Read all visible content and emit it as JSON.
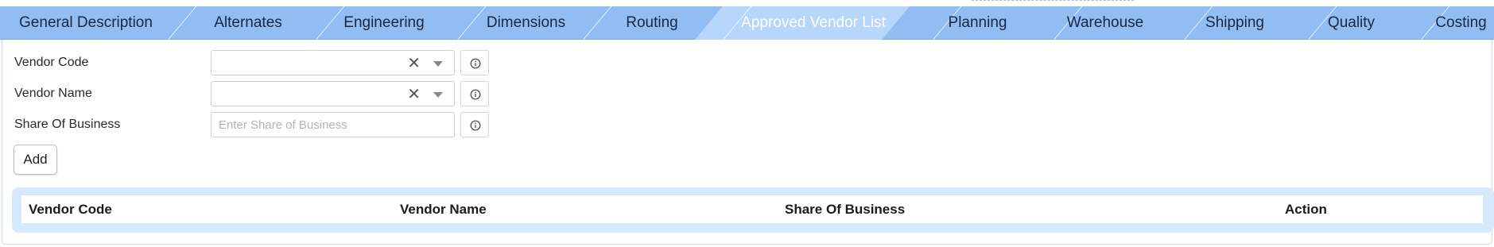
{
  "tabs": [
    {
      "label": "General Description",
      "active": false
    },
    {
      "label": "Alternates",
      "active": false
    },
    {
      "label": "Engineering",
      "active": false
    },
    {
      "label": "Dimensions",
      "active": false
    },
    {
      "label": "Routing",
      "active": false
    },
    {
      "label": "Approved Vendor List",
      "active": true
    },
    {
      "label": "Planning",
      "active": false
    },
    {
      "label": "Warehouse",
      "active": false
    },
    {
      "label": "Shipping",
      "active": false
    },
    {
      "label": "Quality",
      "active": false
    },
    {
      "label": "Costing",
      "active": false
    }
  ],
  "form": {
    "vendor_code": {
      "label": "Vendor Code",
      "value": ""
    },
    "vendor_name": {
      "label": "Vendor Name",
      "value": ""
    },
    "share_of_business": {
      "label": "Share Of Business",
      "value": "",
      "placeholder": "Enter Share of Business"
    },
    "add_label": "Add",
    "clear_glyph": "✕"
  },
  "table": {
    "columns": [
      "Vendor Code",
      "Vendor Name",
      "Share Of Business",
      "Action"
    ],
    "rows": []
  },
  "icons": {
    "info": "info-circle-icon",
    "clear": "close-icon",
    "dropdown": "caret-down-icon"
  },
  "colors": {
    "tabbar": "#91bdf3",
    "tab_active": "#b7d6fb",
    "grid_wrap": "#d6e8fc"
  }
}
